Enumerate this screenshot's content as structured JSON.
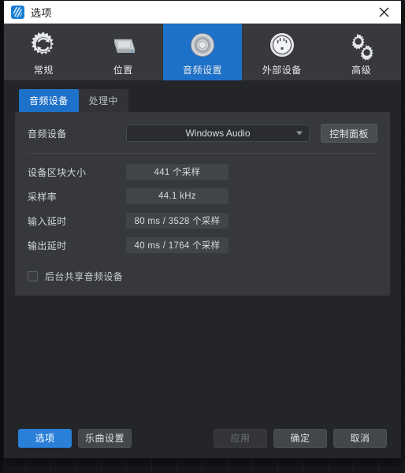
{
  "window": {
    "title": "选项",
    "app_icon": "app-logo-icon",
    "close_icon": "close-icon"
  },
  "topnav": {
    "items": [
      {
        "label": "常规",
        "icon": "refresh-gear-icon",
        "selected": false
      },
      {
        "label": "位置",
        "icon": "hard-drive-icon",
        "selected": false
      },
      {
        "label": "音频设置",
        "icon": "speaker-icon",
        "selected": true
      },
      {
        "label": "外部设备",
        "icon": "midi-din-connector-icon",
        "selected": false
      },
      {
        "label": "高级",
        "icon": "double-gear-icon",
        "selected": false
      }
    ]
  },
  "subtabs": {
    "items": [
      {
        "label": "音频设备",
        "active": true
      },
      {
        "label": "处理中",
        "active": false
      }
    ]
  },
  "panel": {
    "device_row": {
      "label": "音频设备",
      "selected_value": "Windows Audio",
      "caret_icon": "chevron-down-icon",
      "control_panel_button": "控制面板"
    },
    "info_rows": [
      {
        "label": "设备区块大小",
        "value": "441 个采样"
      },
      {
        "label": "采样率",
        "value": "44.1 kHz"
      },
      {
        "label": "输入延时",
        "value": "80 ms / 3528 个采样"
      },
      {
        "label": "输出延时",
        "value": "40 ms / 1764 个采样"
      }
    ],
    "checkbox": {
      "label": "后台共享音频设备",
      "checked": false
    }
  },
  "footer": {
    "buttons": [
      {
        "label": "选项",
        "style": "primary"
      },
      {
        "label": "乐曲设置",
        "style": "normal"
      }
    ],
    "right_buttons": [
      {
        "label": "应用",
        "style": "disabled"
      },
      {
        "label": "确定",
        "style": "normal"
      },
      {
        "label": "取消",
        "style": "normal"
      }
    ]
  },
  "colors": {
    "accent": "#1d71c8",
    "primary_button": "#2a7fd8",
    "titlebar_bg": "#ffffff",
    "nav_bg": "#37393d",
    "content_bg": "#232528",
    "panel_bg": "#36383c"
  }
}
